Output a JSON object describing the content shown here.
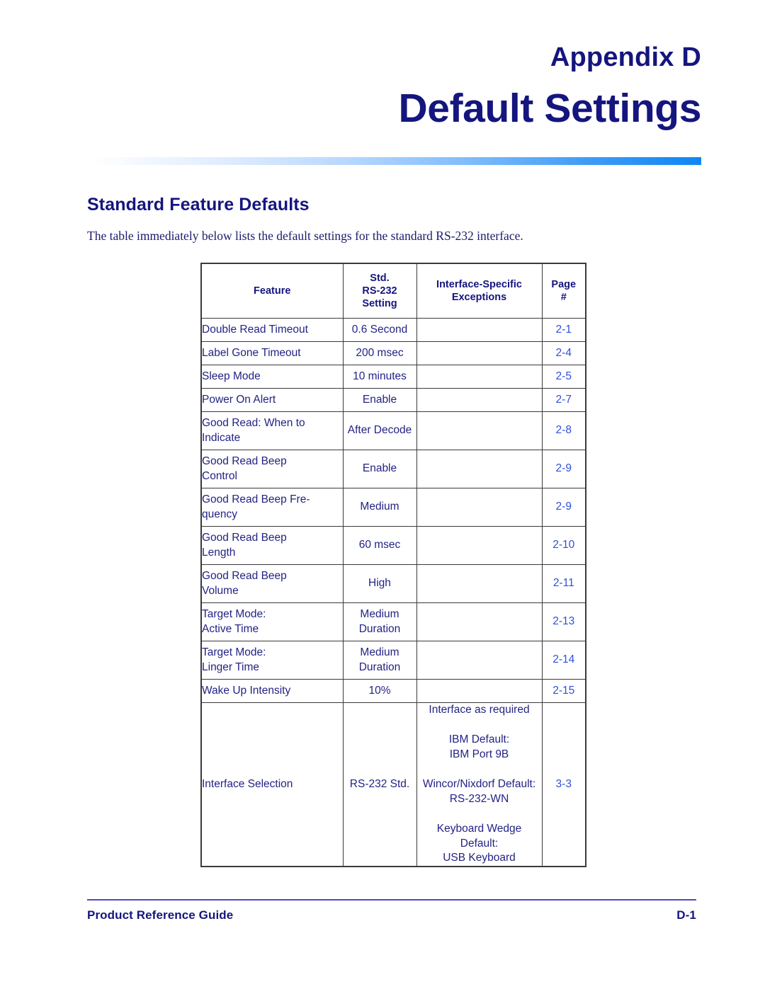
{
  "header": {
    "appendix_label": "Appendix D",
    "chapter_title": "Default Settings",
    "rule_gradient_start": "#ffffff",
    "rule_gradient_end": "#0f86f2"
  },
  "section": {
    "heading": "Standard Feature Defaults",
    "intro": "The table immediately below lists the default settings for the standard RS-232 interface."
  },
  "table": {
    "columns": [
      {
        "label": "Feature"
      },
      {
        "label": "Std.\nRS-232\nSetting",
        "line1": "Std.",
        "line2": "RS-232",
        "line3": "Setting"
      },
      {
        "label": "Interface-Specific Exceptions",
        "line1": "Interface-Specific",
        "line2": "Exceptions"
      },
      {
        "label": "Page #",
        "line1": "Page",
        "line2": "#"
      }
    ],
    "rows": [
      {
        "feature": "Double Read Timeout",
        "setting": "0.6 Second",
        "exceptions": "",
        "page": "2-1"
      },
      {
        "feature": "Label Gone Timeout",
        "setting": "200 msec",
        "exceptions": "",
        "page": "2-4"
      },
      {
        "feature": "Sleep Mode",
        "setting": "10 minutes",
        "exceptions": "",
        "page": "2-5"
      },
      {
        "feature": "Power On Alert",
        "setting": "Enable",
        "exceptions": "",
        "page": "2-7"
      },
      {
        "feature": "Good Read: When to Indicate",
        "setting": "After Decode",
        "exceptions": "",
        "page": "2-8"
      },
      {
        "feature": "Good Read Beep Control",
        "setting": "Enable",
        "exceptions": "",
        "page": "2-9"
      },
      {
        "feature": "Good Read Beep Fre-quency",
        "setting": "Medium",
        "exceptions": "",
        "page": "2-9"
      },
      {
        "feature": "Good Read Beep Length",
        "setting": "60 msec",
        "exceptions": "",
        "page": "2-10"
      },
      {
        "feature": "Good Read Beep Volume",
        "setting": "High",
        "exceptions": "",
        "page": "2-11"
      },
      {
        "feature": "Target Mode: Active Time",
        "setting": "Medium Duration",
        "exceptions": "",
        "page": "2-13"
      },
      {
        "feature": "Target Mode: Linger Time",
        "setting": "Medium Duration",
        "exceptions": "",
        "page": "2-14"
      },
      {
        "feature": "Wake Up Intensity",
        "setting": "10%",
        "exceptions": "",
        "page": "2-15"
      },
      {
        "feature": "Interface Selection",
        "setting": "RS-232 Std.",
        "exceptions": "",
        "page": "3-3"
      }
    ],
    "interface_selection_exceptions": [
      "Interface as required",
      "IBM Default:\nIBM Port 9B",
      "Wincor/Nixdorf Default:\nRS-232-WN",
      "Keyboard Wedge Default:\nUSB Keyboard"
    ],
    "row_parts": {
      "r5_l1": "Good Read: When to",
      "r5_l2": "Indicate",
      "r6_l1": "Good Read Beep",
      "r6_l2": "Control",
      "r7_l1": "Good Read Beep Fre-",
      "r7_l2": "quency",
      "r8_l1": "Good Read Beep",
      "r8_l2": "Length",
      "r9_l1": "Good Read Beep",
      "r9_l2": "Volume",
      "r10_l1": "Target Mode:",
      "r10_l2": "Active Time",
      "r10_s1": "Medium",
      "r10_s2": "Duration",
      "r11_l1": "Target Mode:",
      "r11_l2": "Linger Time",
      "r11_s1": "Medium",
      "r11_s2": "Duration",
      "e1": "Interface as required",
      "e2a": "IBM Default:",
      "e2b": "IBM Port 9B",
      "e3a": "Wincor/Nixdorf Default:",
      "e3b": "RS-232-WN",
      "e4a": "Keyboard Wedge",
      "e4b": "Default:",
      "e4c": "USB Keyboard"
    }
  },
  "footer": {
    "left": "Product Reference Guide",
    "right": "D-1"
  }
}
